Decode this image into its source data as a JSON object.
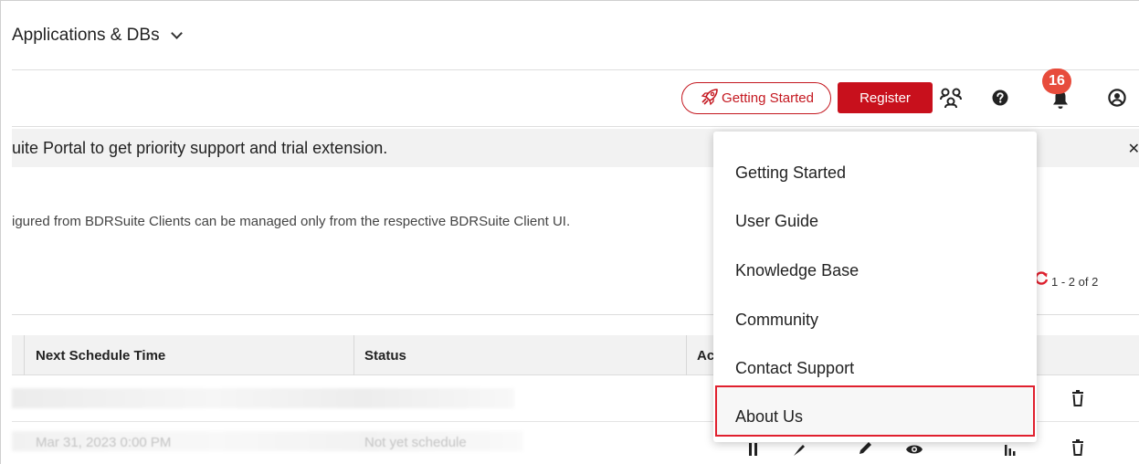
{
  "nav": {
    "menu_label": "Applications & DBs"
  },
  "toolbar": {
    "getting_started_label": "Getting Started",
    "register_label": "Register",
    "notification_count": "16"
  },
  "banner": {
    "text": "uite Portal to get priority support and trial extension."
  },
  "info_text": "igured from BDRSuite Clients can be managed only from the respective BDRSuite Client UI.",
  "pager": {
    "range": "1 - 2 of 2"
  },
  "table": {
    "columns": [
      "Next Schedule Time",
      "Status",
      "Ac"
    ],
    "rows": [
      {
        "next_schedule": "",
        "status": ""
      },
      {
        "next_schedule": "Mar 31, 2023 0:00 PM",
        "status": "Not yet schedule"
      }
    ]
  },
  "help_menu": {
    "items": [
      "Getting Started",
      "User Guide",
      "Knowledge Base",
      "Community",
      "Contact Support",
      "About Us"
    ],
    "highlighted": "About Us"
  },
  "colors": {
    "brand_red": "#c8101c",
    "badge": "#e74c3c",
    "highlight_border": "#e0202e"
  }
}
